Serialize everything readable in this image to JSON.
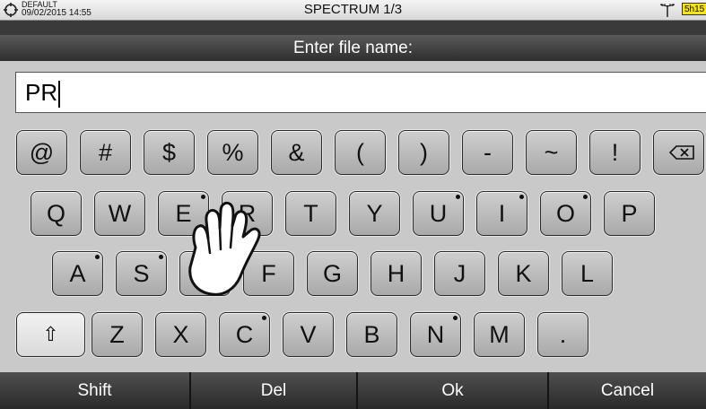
{
  "status": {
    "profile": "DEFAULT",
    "datetime": "09/02/2015 14:55",
    "title": "SPECTRUM 1/3",
    "battery": "5h15"
  },
  "prompt": "Enter file name:",
  "input": {
    "value": "PR"
  },
  "keyboard": {
    "row1": [
      "@",
      "#",
      "$",
      "%",
      "&",
      "(",
      ")",
      "-",
      "~",
      "!"
    ],
    "row2": [
      "Q",
      "W",
      "E",
      "R",
      "T",
      "Y",
      "U",
      "I",
      "O",
      "P"
    ],
    "row3": [
      "A",
      "S",
      "D",
      "F",
      "G",
      "H",
      "J",
      "K",
      "L"
    ],
    "row4": [
      "Z",
      "X",
      "C",
      "V",
      "B",
      "N",
      "M",
      "."
    ],
    "shift_glyph": "⇧",
    "backspace_icon": "backspace-icon"
  },
  "softkeys": [
    "Shift",
    "Del",
    "Ok",
    "Cancel"
  ],
  "colors": {
    "battery": "#f4e21a",
    "shift_key": "#f2f2f2"
  }
}
